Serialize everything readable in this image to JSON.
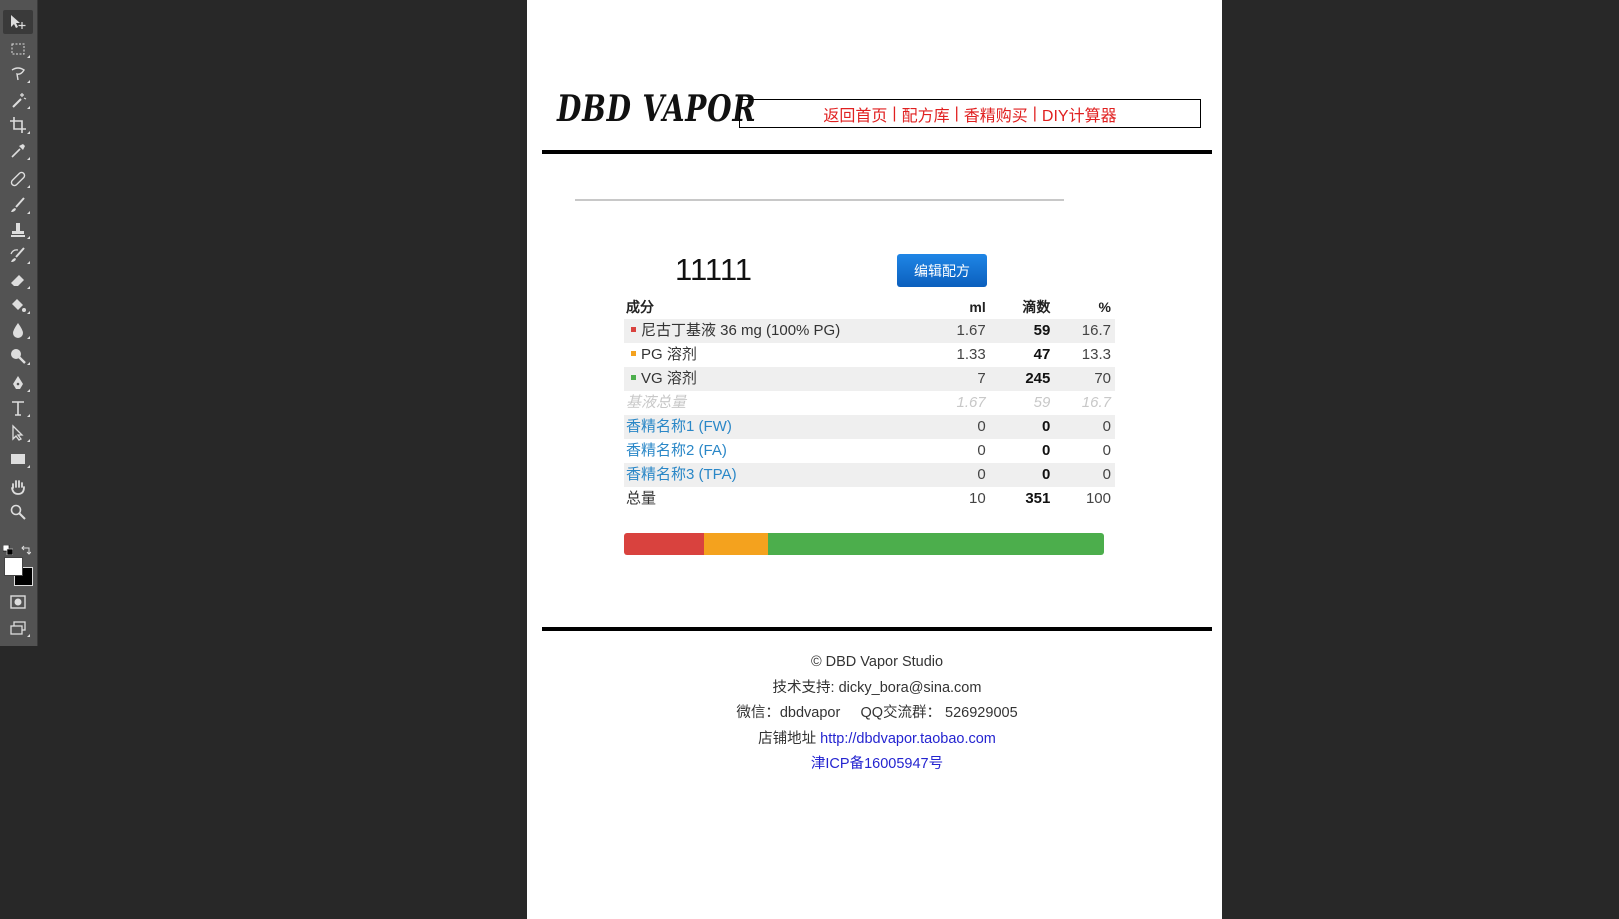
{
  "toolbar": {
    "tools": [
      "move-tool",
      "marquee-tool",
      "lasso-tool",
      "magic-wand-tool",
      "crop-tool",
      "eyedropper-tool",
      "healing-brush-tool",
      "brush-tool",
      "clone-stamp-tool",
      "history-brush-tool",
      "eraser-tool",
      "paint-bucket-tool",
      "blur-tool",
      "dodge-tool",
      "pen-tool",
      "type-tool",
      "path-selection-tool",
      "rectangle-tool",
      "hand-tool",
      "zoom-tool"
    ],
    "foreground_color": "#ffffff",
    "background_color": "#000000"
  },
  "site": {
    "logo": "DBD VAPOR",
    "nav": [
      "返回首页",
      "配方库",
      "香精购买",
      "DIY计算器"
    ],
    "nav_separator": "|"
  },
  "recipe": {
    "title": "11111",
    "edit_button": "编辑配方",
    "headers": {
      "name": "成分",
      "ml": "ml",
      "drops": "滴数",
      "percent": "%"
    },
    "rows": [
      {
        "name": "尼古丁基液 36 mg (100% PG)",
        "ml": "1.67",
        "drops": "59",
        "percent": "16.7",
        "color": "#d9423e",
        "type": "base"
      },
      {
        "name": "PG 溶剂",
        "ml": "1.33",
        "drops": "47",
        "percent": "13.3",
        "color": "#f4a21e",
        "type": "base"
      },
      {
        "name": "VG 溶剂",
        "ml": "7",
        "drops": "245",
        "percent": "70",
        "color": "#4cae4c",
        "type": "base"
      },
      {
        "name": "基液总量",
        "ml": "1.67",
        "drops": "59",
        "percent": "16.7",
        "type": "subtotal"
      },
      {
        "name": "香精名称1 (FW)",
        "ml": "0",
        "drops": "0",
        "percent": "0",
        "type": "flavor"
      },
      {
        "name": "香精名称2 (FA)",
        "ml": "0",
        "drops": "0",
        "percent": "0",
        "type": "flavor"
      },
      {
        "name": "香精名称3 (TPA)",
        "ml": "0",
        "drops": "0",
        "percent": "0",
        "type": "flavor"
      },
      {
        "name": "总量",
        "ml": "10",
        "drops": "351",
        "percent": "100",
        "type": "total"
      }
    ],
    "composition_bar": [
      {
        "label": "尼古丁基液",
        "percent": 16.7,
        "color": "#d9423e"
      },
      {
        "label": "PG 溶剂",
        "percent": 13.3,
        "color": "#f4a21e"
      },
      {
        "label": "VG 溶剂",
        "percent": 70,
        "color": "#4cae4c"
      }
    ]
  },
  "footer": {
    "copyright": "© DBD Vapor Studio",
    "support": "技术支持: dicky_bora@sina.com",
    "wechat": "微信：dbdvapor",
    "qq": "QQ交流群： 526929005",
    "store_label": "店铺地址",
    "store_url": "http://dbdvapor.taobao.com",
    "icp": "津ICP备16005947号"
  }
}
